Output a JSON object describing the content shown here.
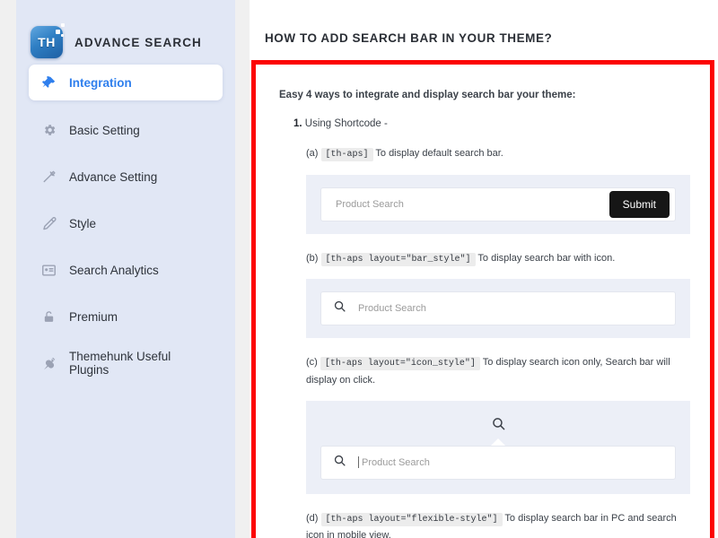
{
  "sidebar": {
    "brand": {
      "logo_text": "TH",
      "title": "ADVANCE SEARCH"
    },
    "items": [
      {
        "label": "Integration",
        "icon": "pushpin-icon",
        "active": true
      },
      {
        "label": "Basic Setting",
        "icon": "gear-icon",
        "active": false
      },
      {
        "label": "Advance Setting",
        "icon": "hammer-icon",
        "active": false
      },
      {
        "label": "Style",
        "icon": "eyedropper-icon",
        "active": false
      },
      {
        "label": "Search Analytics",
        "icon": "analytics-card-icon",
        "active": false
      },
      {
        "label": "Premium",
        "icon": "unlock-icon",
        "active": false
      },
      {
        "label": "Themehunk Useful Plugins",
        "icon": "plug-icon",
        "active": false
      }
    ]
  },
  "main": {
    "page_title": "HOW TO ADD SEARCH BAR IN YOUR THEME?",
    "intro": "Easy 4 ways to integrate and display search bar your theme:",
    "step_number": "1.",
    "step_label": "Using Shortcode -",
    "items": [
      {
        "marker": "(a)",
        "shortcode": "[th-aps]",
        "description": "To display default search bar.",
        "preview": "input-with-submit",
        "placeholder": "Product Search",
        "submit_label": "Submit"
      },
      {
        "marker": "(b)",
        "shortcode": "[th-aps layout=\"bar_style\"]",
        "description": "To display search bar with icon.",
        "preview": "input-with-search-icon",
        "placeholder": "Product Search"
      },
      {
        "marker": "(c)",
        "shortcode": "[th-aps layout=\"icon_style\"]",
        "description": "To display search icon only, Search bar will display on click.",
        "preview": "icon-then-input",
        "placeholder": "Product Search"
      },
      {
        "marker": "(d)",
        "shortcode": "[th-aps layout=\"flexible-style\"]",
        "description": "To display search bar in PC and search icon in mobile view.",
        "preview": "none"
      }
    ]
  },
  "colors": {
    "sidebar_bg": "#e1e7f5",
    "accent": "#2f7fed",
    "highlight_border": "#fc0404",
    "preview_bg": "#eceff7",
    "submit_bg": "#161616"
  }
}
